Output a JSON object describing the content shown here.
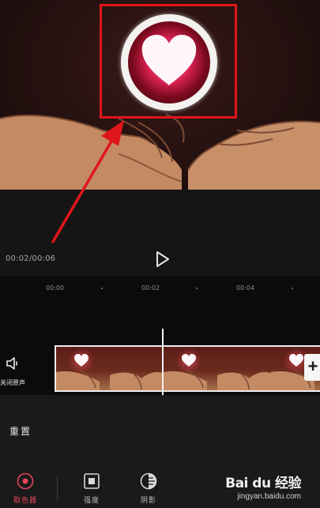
{
  "player": {
    "time_readout": "00:02/00:06",
    "play_icon": "play-icon"
  },
  "timeline": {
    "ticks": [
      "00:00",
      "00:02",
      "00:04"
    ]
  },
  "track": {
    "mute_label": "关闭原声",
    "speaker_icon": "speaker-icon",
    "add_icon": "plus-icon"
  },
  "panel": {
    "reset_label": "重置",
    "tools": [
      {
        "label": "取色器",
        "icon": "color-picker-icon",
        "active": true
      },
      {
        "label": "强度",
        "icon": "intensity-icon",
        "active": false
      },
      {
        "label": "阴影",
        "icon": "shadow-icon",
        "active": false
      }
    ]
  },
  "watermark": {
    "brand": "Bai du 经验",
    "url": "jingyan.baidu.com"
  },
  "colors": {
    "accent": "#e6475a",
    "annotation_red": "#e0161c",
    "background": "#0e0e0f",
    "panel": "#1a1a1b"
  }
}
